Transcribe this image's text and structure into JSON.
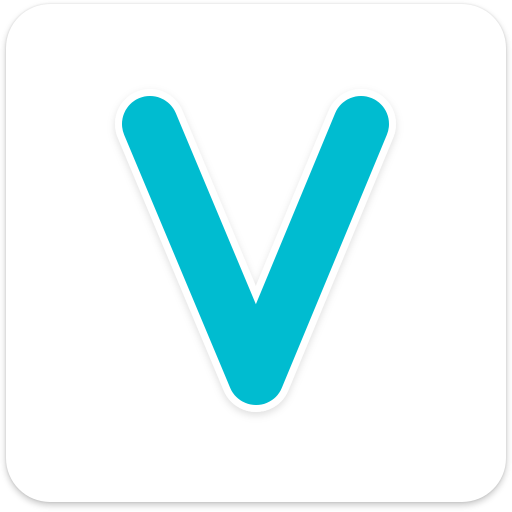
{
  "app_icon": {
    "glyph_name": "v-letter-logo",
    "colors": {
      "tile_background": "#ffffff",
      "logo_fill": "#00bcd0",
      "logo_outline": "#ffffff"
    }
  }
}
